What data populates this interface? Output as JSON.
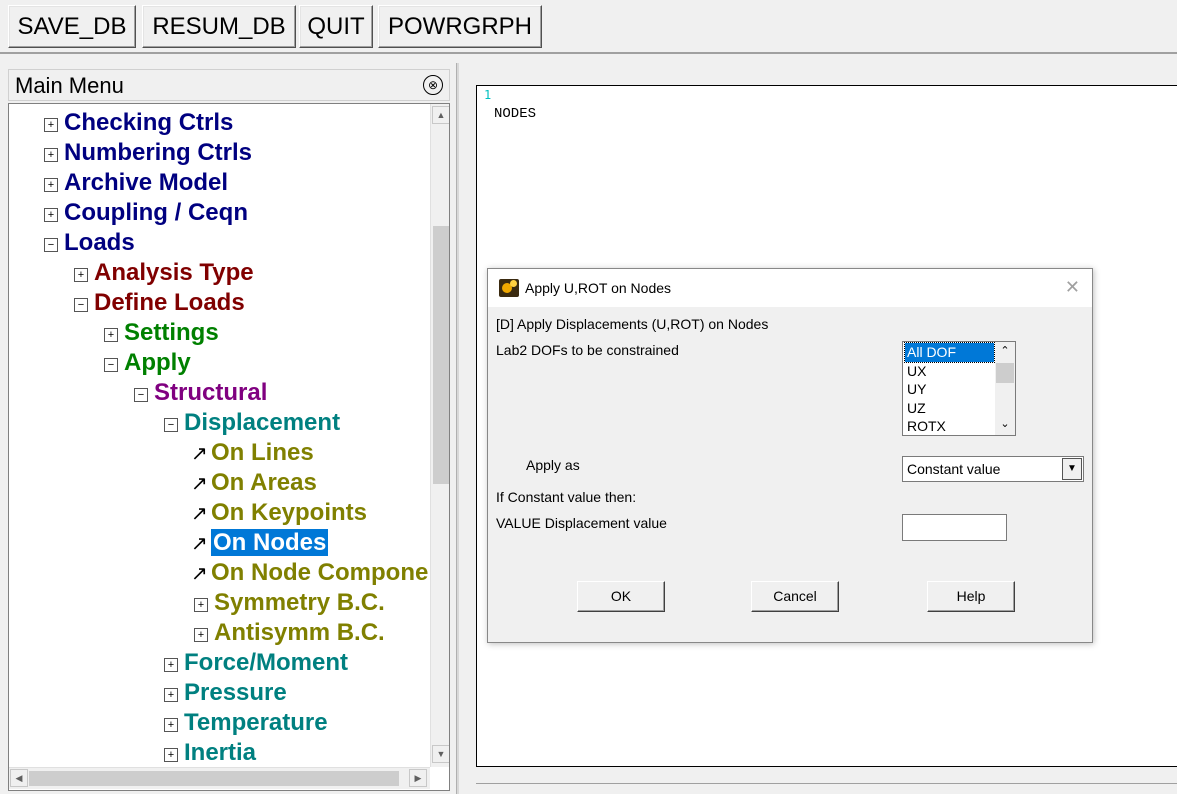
{
  "toolbar": {
    "buttons": [
      "SAVE_DB",
      "RESUM_DB",
      "QUIT",
      "POWRGRPH"
    ]
  },
  "main_menu": {
    "title": "Main Menu",
    "collapse_glyph": "⊗",
    "items": [
      {
        "label": "Checking Ctrls",
        "expander": "⊞",
        "color": "#000080"
      },
      {
        "label": "Numbering Ctrls",
        "expander": "⊞",
        "color": "#000080"
      },
      {
        "label": "Archive Model",
        "expander": "⊞",
        "color": "#000080"
      },
      {
        "label": "Coupling / Ceqn",
        "expander": "⊞",
        "color": "#000080"
      },
      {
        "label": "Loads",
        "expander": "⊟",
        "color": "#000080"
      },
      {
        "label": "Analysis Type",
        "expander": "⊞",
        "color": "#800000"
      },
      {
        "label": "Define Loads",
        "expander": "⊟",
        "color": "#800000"
      },
      {
        "label": "Settings",
        "expander": "⊞",
        "color": "#008000"
      },
      {
        "label": "Apply",
        "expander": "⊟",
        "color": "#008000"
      },
      {
        "label": "Structural",
        "expander": "⊟",
        "color": "#800080"
      },
      {
        "label": "Displacement",
        "expander": "⊟",
        "color": "#008080"
      },
      {
        "label": "On Lines",
        "expander": "↗",
        "color": "#808000"
      },
      {
        "label": "On Areas",
        "expander": "↗",
        "color": "#808000"
      },
      {
        "label": "On Keypoints",
        "expander": "↗",
        "color": "#808000"
      },
      {
        "label": "On Nodes",
        "expander": "↗",
        "color": "#808000",
        "selected": true
      },
      {
        "label": "On Node Compone",
        "expander": "↗",
        "color": "#808000"
      },
      {
        "label": "Symmetry B.C.",
        "expander": "⊞",
        "color": "#808000"
      },
      {
        "label": "Antisymm B.C.",
        "expander": "⊞",
        "color": "#808000"
      },
      {
        "label": "Force/Moment",
        "expander": "⊞",
        "color": "#008080"
      },
      {
        "label": "Pressure",
        "expander": "⊞",
        "color": "#008080"
      },
      {
        "label": "Temperature",
        "expander": "⊞",
        "color": "#008080"
      },
      {
        "label": "Inertia",
        "expander": "⊞",
        "color": "#008080"
      }
    ]
  },
  "graphics": {
    "window_number": "1",
    "label": "NODES"
  },
  "dialog": {
    "title": "Apply U,ROT on Nodes",
    "close_glyph": "✕",
    "heading": "[D]  Apply Displacements (U,ROT) on Nodes",
    "lab2": "Lab2   DOFs to be constrained",
    "dof_options": [
      "All DOF",
      "UX",
      "UY",
      "UZ",
      "ROTX"
    ],
    "apply_as_label": "Apply as",
    "apply_as_value": "Constant value",
    "if_constant_label": "If Constant value then:",
    "value_label": "VALUE   Displacement value",
    "value_input": "",
    "buttons": {
      "ok": "OK",
      "cancel": "Cancel",
      "help": "Help"
    }
  }
}
